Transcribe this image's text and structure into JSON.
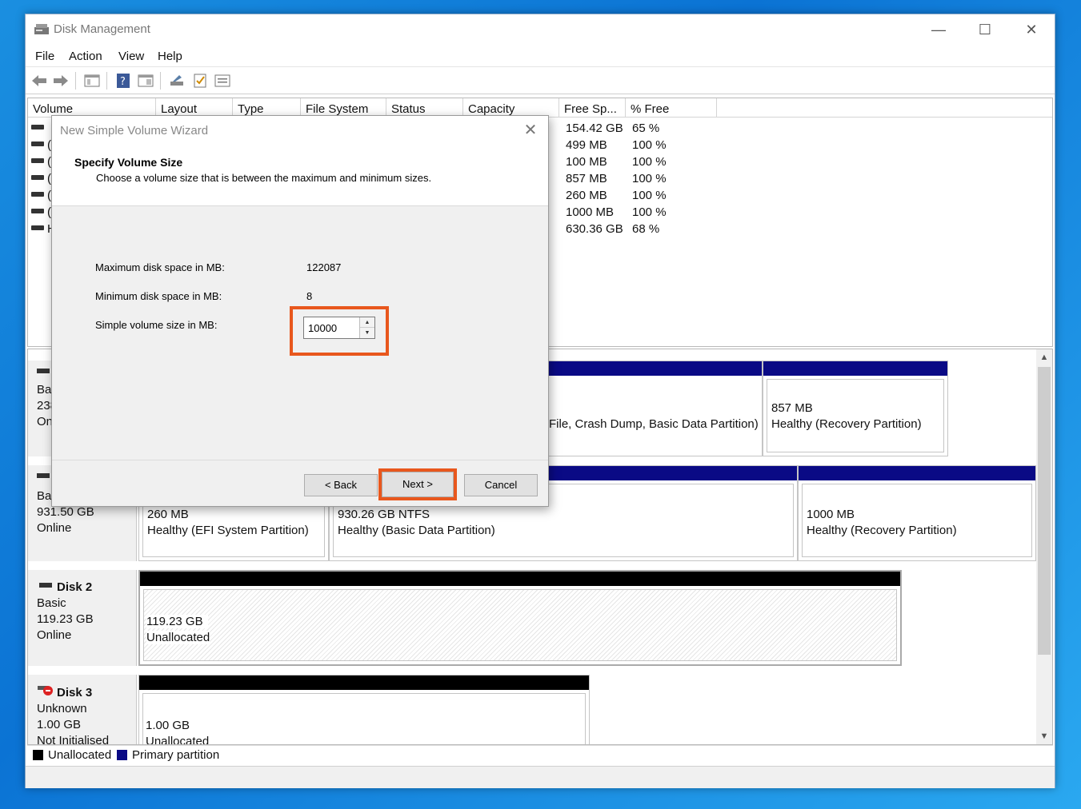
{
  "window": {
    "title": "Disk Management",
    "controls": {
      "minimize": "—",
      "maximize": "☐",
      "close": "✕"
    }
  },
  "menu": [
    "File",
    "Action",
    "View",
    "Help"
  ],
  "toolbar_icons": [
    "back-arrow-icon",
    "forward-arrow-icon",
    "console-tree-icon",
    "help-icon",
    "properties-icon",
    "connect-icon",
    "check-icon",
    "list-view-icon"
  ],
  "volume_list": {
    "columns": [
      "Volume",
      "Layout",
      "Type",
      "File System",
      "Status",
      "Capacity",
      "Free Sp...",
      "% Free"
    ],
    "rows": [
      {
        "volume": "",
        "free": "154.42 GB",
        "pct": "65 %"
      },
      {
        "volume": "(",
        "free": "499 MB",
        "pct": "100 %"
      },
      {
        "volume": "(",
        "free": "100 MB",
        "pct": "100 %"
      },
      {
        "volume": "(",
        "free": "857 MB",
        "pct": "100 %"
      },
      {
        "volume": "(",
        "free": "260 MB",
        "pct": "100 %"
      },
      {
        "volume": "(",
        "free": "1000 MB",
        "pct": "100 %"
      },
      {
        "volume": "H",
        "free": "630.36 GB",
        "pct": "68 %"
      }
    ]
  },
  "disks": [
    {
      "lines": [
        "Bas",
        "238",
        "On"
      ],
      "partitions": [
        {
          "line1": "",
          "line2": "File, Crash Dump, Basic Data Partition)"
        },
        {
          "line1": "857 MB",
          "line2": "Healthy (Recovery Partition)"
        }
      ]
    },
    {
      "lines": [
        "Bas",
        "931.50 GB",
        "Online"
      ],
      "partitions": [
        {
          "line1": "260 MB",
          "line2": "Healthy (EFI System Partition)"
        },
        {
          "line1": "930.26 GB NTFS",
          "line2": "Healthy (Basic Data Partition)"
        },
        {
          "line1": "1000 MB",
          "line2": "Healthy (Recovery Partition)"
        }
      ]
    },
    {
      "name": "Disk 2",
      "lines": [
        "Basic",
        "119.23 GB",
        "Online"
      ],
      "partitions": [
        {
          "line1": "119.23 GB",
          "line2": "Unallocated"
        }
      ]
    },
    {
      "name": "Disk 3",
      "lines": [
        "Unknown",
        "1.00 GB",
        "Not Initialised"
      ],
      "partitions": [
        {
          "line1": "1.00 GB",
          "line2": "Unallocated"
        }
      ]
    }
  ],
  "legend": [
    {
      "label": "Unallocated",
      "color": "#000000"
    },
    {
      "label": "Primary partition",
      "color": "#0a0a85"
    }
  ],
  "wizard": {
    "title": "New Simple Volume Wizard",
    "heading": "Specify Volume Size",
    "subheading": "Choose a volume size that is between the maximum and minimum sizes.",
    "max_label": "Maximum disk space in MB:",
    "max_value": "122087",
    "min_label": "Minimum disk space in MB:",
    "min_value": "8",
    "size_label": "Simple volume size in MB:",
    "size_value": "10000",
    "back_label": "< Back",
    "next_label": "Next >",
    "cancel_label": "Cancel",
    "highlight_color": "#e8571d"
  }
}
